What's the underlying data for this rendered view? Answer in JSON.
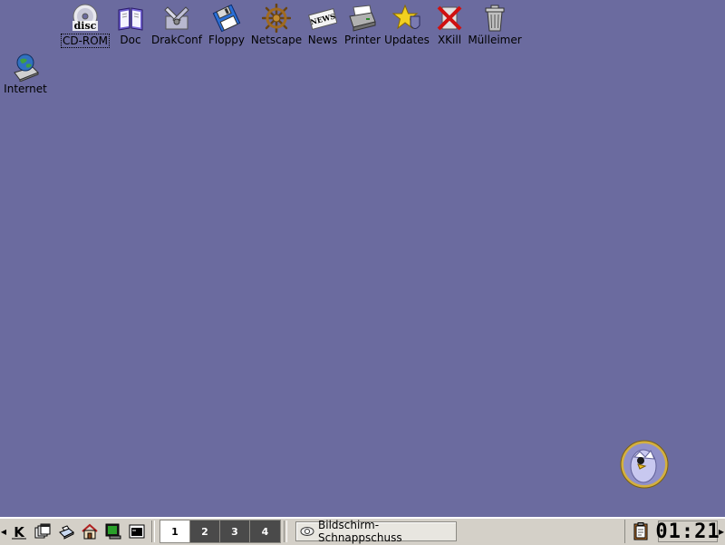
{
  "desktop": {
    "background": "#6b6b9f",
    "icons": [
      {
        "label": "CD-ROM",
        "icon": "cdrom-icon",
        "selected": true
      },
      {
        "label": "Doc",
        "icon": "book-icon"
      },
      {
        "label": "DrakConf",
        "icon": "tools-icon"
      },
      {
        "label": "Floppy",
        "icon": "floppy-icon"
      },
      {
        "label": "Netscape",
        "icon": "ship-wheel-icon"
      },
      {
        "label": "News",
        "icon": "newspaper-icon"
      },
      {
        "label": "Printer",
        "icon": "printer-icon"
      },
      {
        "label": "Updates",
        "icon": "star-shield-icon"
      },
      {
        "label": "XKill",
        "icon": "xkill-icon"
      },
      {
        "label": "Mülleimer",
        "icon": "trash-icon"
      },
      {
        "label": "Internet",
        "icon": "globe-icon"
      }
    ],
    "cdrom_overlay": "disc"
  },
  "taskbar": {
    "pager": [
      "1",
      "2",
      "3",
      "4"
    ],
    "active_desktop": "1",
    "task_label": "Bildschirm-Schnappschuss",
    "clock": "01:21",
    "quicklaunch": [
      "kde-menu-icon",
      "window-list-icon",
      "system-icon",
      "home-icon",
      "terminal-green-icon",
      "terminal-icon"
    ]
  }
}
